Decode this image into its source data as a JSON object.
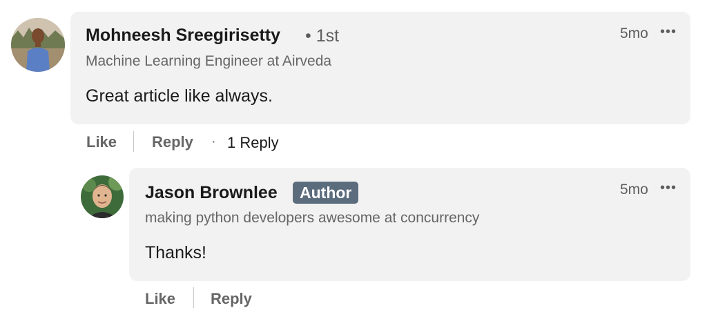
{
  "comment": {
    "author": "Mohneesh Sreegirisetty",
    "connection": "• 1st",
    "headline": "Machine Learning Engineer at Airveda",
    "text": "Great article like always.",
    "time": "5mo",
    "more": "•••",
    "actions": {
      "like": "Like",
      "reply": "Reply",
      "separator": "·",
      "reply_count": "1 Reply"
    }
  },
  "reply": {
    "author": "Jason Brownlee",
    "badge": "Author",
    "headline": "making python developers awesome at concurrency",
    "text": "Thanks!",
    "time": "5mo",
    "more": "•••",
    "actions": {
      "like": "Like",
      "reply": "Reply"
    }
  },
  "icons": {
    "avatar_1": "profile-photo",
    "avatar_2": "profile-photo",
    "more": "more-options-icon"
  }
}
